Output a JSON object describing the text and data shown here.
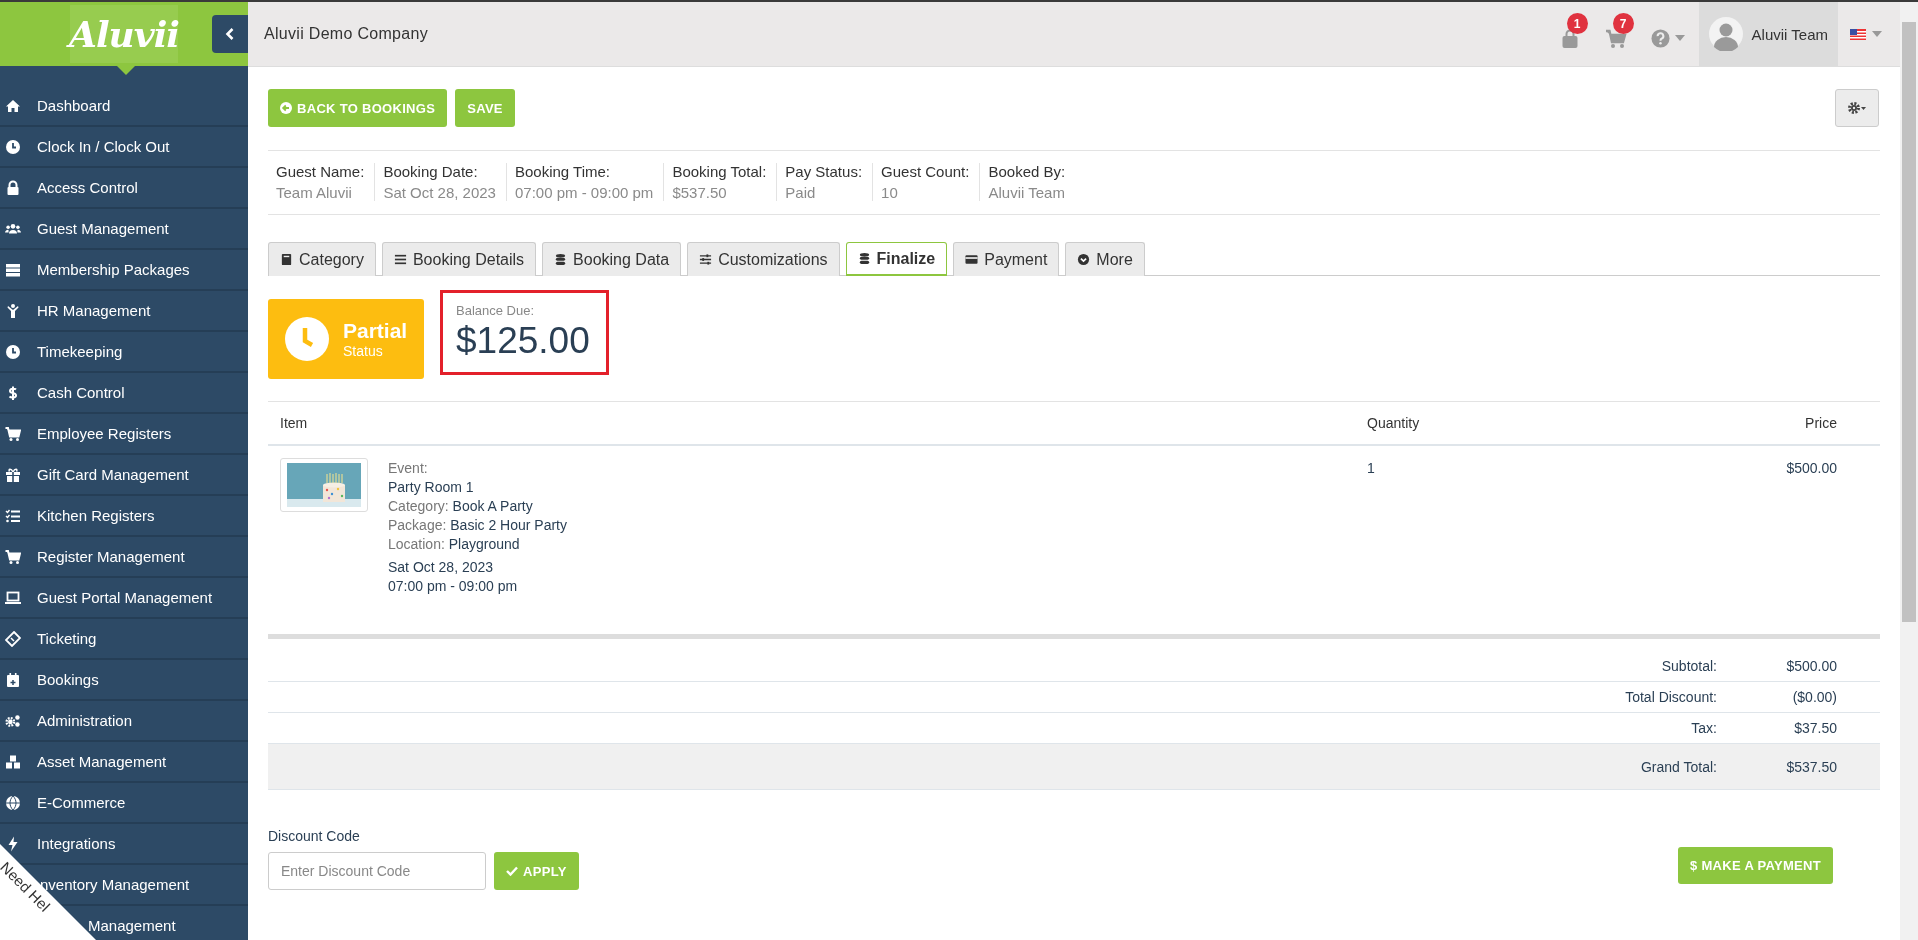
{
  "logo": {
    "text": "Aluvii"
  },
  "sidebar": {
    "items": [
      {
        "label": "Dashboard"
      },
      {
        "label": "Clock In / Clock Out"
      },
      {
        "label": "Access Control"
      },
      {
        "label": "Guest Management"
      },
      {
        "label": "Membership Packages"
      },
      {
        "label": "HR Management"
      },
      {
        "label": "Timekeeping"
      },
      {
        "label": "Cash Control"
      },
      {
        "label": "Employee Registers"
      },
      {
        "label": "Gift Card Management"
      },
      {
        "label": "Kitchen Registers"
      },
      {
        "label": "Register Management"
      },
      {
        "label": "Guest Portal Management"
      },
      {
        "label": "Ticketing"
      },
      {
        "label": "Bookings"
      },
      {
        "label": "Administration"
      },
      {
        "label": "Asset Management"
      },
      {
        "label": "E-Commerce"
      },
      {
        "label": "Integrations"
      },
      {
        "label": "nventory Management"
      },
      {
        "label": "Management"
      }
    ]
  },
  "header": {
    "company": "Aluvii Demo Company",
    "notifications": [
      "1",
      "7"
    ],
    "user": "Aluvii Team"
  },
  "actions": [
    "BACK TO BOOKINGS",
    "SAVE"
  ],
  "summary": [
    {
      "label": "Guest Name:",
      "value": "Team Aluvii"
    },
    {
      "label": "Booking Date:",
      "value": "Sat Oct 28, 2023"
    },
    {
      "label": "Booking Time:",
      "value": "07:00 pm - 09:00 pm"
    },
    {
      "label": "Booking Total:",
      "value": "$537.50"
    },
    {
      "label": "Pay Status:",
      "value": "Paid"
    },
    {
      "label": "Guest Count:",
      "value": "10"
    },
    {
      "label": "Booked By:",
      "value": "Aluvii Team"
    }
  ],
  "tabs": [
    {
      "label": "Category",
      "selected": false
    },
    {
      "label": "Booking Details",
      "selected": false
    },
    {
      "label": "Booking Data",
      "selected": false
    },
    {
      "label": "Customizations",
      "selected": false
    },
    {
      "label": "Finalize",
      "selected": true
    },
    {
      "label": "Payment",
      "selected": false
    },
    {
      "label": "More",
      "selected": false
    }
  ],
  "status": {
    "label": "Partial",
    "caption": "Status"
  },
  "balance": {
    "label": "Balance Due:",
    "amount": "$125.00"
  },
  "table": {
    "columns": [
      "Item",
      "Quantity",
      "Price"
    ],
    "rows": [
      {
        "details": [
          {
            "label": "Event:"
          },
          {
            "value": "Party Room 1"
          },
          {
            "label": "Category:",
            "value": "Book A Party"
          },
          {
            "label": "Package:",
            "value": "Basic 2 Hour Party"
          },
          {
            "label": "Location:",
            "value": "Playground"
          }
        ],
        "date": "Sat Oct 28, 2023",
        "time": "07:00 pm - 09:00 pm",
        "quantity": "1",
        "price": "$500.00"
      }
    ]
  },
  "totals": [
    {
      "label": "Subtotal:",
      "value": "$500.00",
      "highlighted": false
    },
    {
      "label": "Total Discount:",
      "value": "($0.00)",
      "highlighted": false
    },
    {
      "label": "Tax:",
      "value": "$37.50",
      "highlighted": false
    },
    {
      "label": "Grand Total:",
      "value": "$537.50",
      "highlighted": true
    }
  ],
  "discount": {
    "label": "Discount Code",
    "placeholder": "Enter Discount Code",
    "button": "APPLY"
  },
  "payment_button": "$ MAKE A PAYMENT",
  "help_ribbon": {
    "text": "Need Hel"
  }
}
